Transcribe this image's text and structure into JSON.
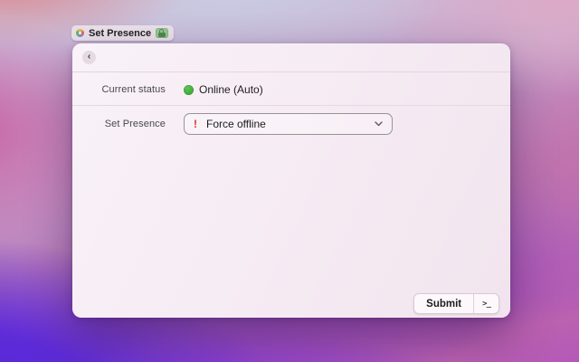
{
  "tab": {
    "title": "Set Presence"
  },
  "icons": {
    "app": "pinwheel-app-icon",
    "lock": "lock-icon",
    "back": "‹",
    "warning": "!",
    "chevron_down": "chevron-down-icon",
    "terminal": ">_",
    "status_dot": "green-circle-icon"
  },
  "page": {
    "current_status": {
      "label": "Current status",
      "value": "Online (Auto)"
    },
    "set_presence": {
      "label": "Set Presence",
      "selected": "Force offline"
    },
    "actions": {
      "submit": "Submit"
    }
  },
  "colors": {
    "online_green": "#3fae3c",
    "warning_red": "#d7352c",
    "lock_green": "#97c992",
    "window_bg": "#f6ecf4",
    "wallpaper_purple": "#5e2bd8",
    "wallpaper_magenta": "#c7579e"
  }
}
